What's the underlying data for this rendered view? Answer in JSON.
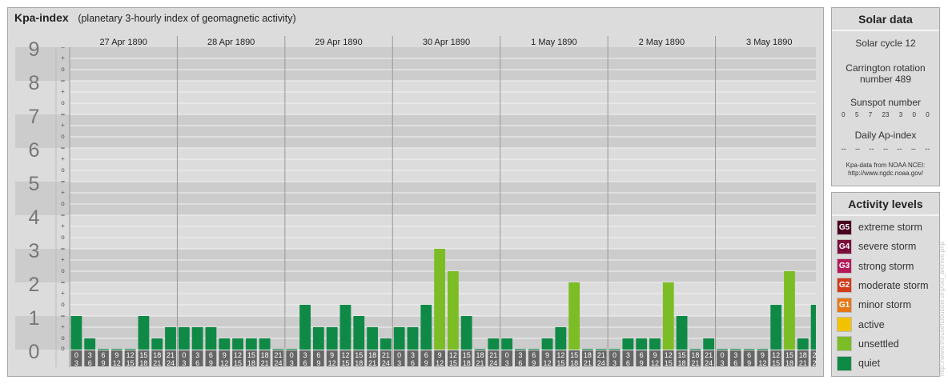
{
  "header": {
    "title": "Kpa-index",
    "subtitle": "(planetary 3-hourly index of geomagnetic activity)"
  },
  "chart_data": {
    "type": "bar",
    "title": "Kpa-index",
    "subtitle": "(planetary 3-hourly index of geomagnetic activity)",
    "ylim": [
      0,
      9
    ],
    "y_ticks": [
      "0",
      "1",
      "2",
      "3",
      "4",
      "5",
      "6",
      "7",
      "8",
      "9"
    ],
    "minor_marks": [
      "–",
      "o",
      "+"
    ],
    "days": [
      "27 Apr 1890",
      "28 Apr 1890",
      "29 Apr 1890",
      "30 Apr 1890",
      "1 May 1890",
      "2 May 1890",
      "3 May 1890"
    ],
    "interval_top": [
      "0",
      "3",
      "6",
      "9",
      "12",
      "15",
      "18",
      "21"
    ],
    "interval_bottom": [
      "3",
      "6",
      "9",
      "12",
      "15",
      "18",
      "21",
      "24"
    ],
    "values": [
      [
        1.0,
        0.333,
        0,
        0,
        0,
        1.0,
        0.333,
        0.667
      ],
      [
        0.667,
        0.667,
        0.667,
        0.333,
        0.333,
        0.333,
        0.333,
        0
      ],
      [
        0,
        1.333,
        0.667,
        0.667,
        1.333,
        1.0,
        0.667,
        0.333
      ],
      [
        0.667,
        0.667,
        1.333,
        3.0,
        2.333,
        1.0,
        0,
        0.333
      ],
      [
        0.333,
        0,
        0,
        0.333,
        0.667,
        2.0,
        0,
        0
      ],
      [
        0,
        0.333,
        0.333,
        0.333,
        2.0,
        1.0,
        0,
        0.333
      ],
      [
        0,
        0,
        0,
        0,
        1.333,
        2.333,
        0.333,
        1.333
      ]
    ],
    "colors": {
      "quiet": "#0f8a46",
      "unsettled": "#7cbd25"
    },
    "grid": true
  },
  "solar": {
    "title": "Solar data",
    "cycle": "Solar cycle 12",
    "carrington_1": "Carrington rotation",
    "carrington_2": "number 489",
    "sunspot_label": "Sunspot number",
    "sunspots": [
      "0",
      "5",
      "7",
      "23",
      "3",
      "0",
      "0"
    ],
    "ap_label": "Daily Ap-index",
    "ap": [
      "--",
      "--",
      "--",
      "--",
      "--",
      "--",
      "--"
    ],
    "source_1": "Kpa-data from NOAA NCEI:",
    "source_2": "http://www.ngdc.noaa.gov/"
  },
  "levels": {
    "title": "Activity levels",
    "items": [
      {
        "badge": "G5",
        "label": "extreme storm",
        "color": "#4a0020"
      },
      {
        "badge": "G4",
        "label": "severe storm",
        "color": "#7a0e3a"
      },
      {
        "badge": "G3",
        "label": "strong storm",
        "color": "#b5195a"
      },
      {
        "badge": "G2",
        "label": "moderate storm",
        "color": "#d23a1a"
      },
      {
        "badge": "G1",
        "label": "minor storm",
        "color": "#e67817"
      },
      {
        "badge": "",
        "label": "active",
        "color": "#f2c200"
      },
      {
        "badge": "",
        "label": "unsettled",
        "color": "#7cbd25"
      },
      {
        "badge": "",
        "label": "quiet",
        "color": "#0f8a46"
      }
    ]
  },
  "footer": {
    "side_url": "http://www.theusefulbubble.org/old_archive.php"
  }
}
